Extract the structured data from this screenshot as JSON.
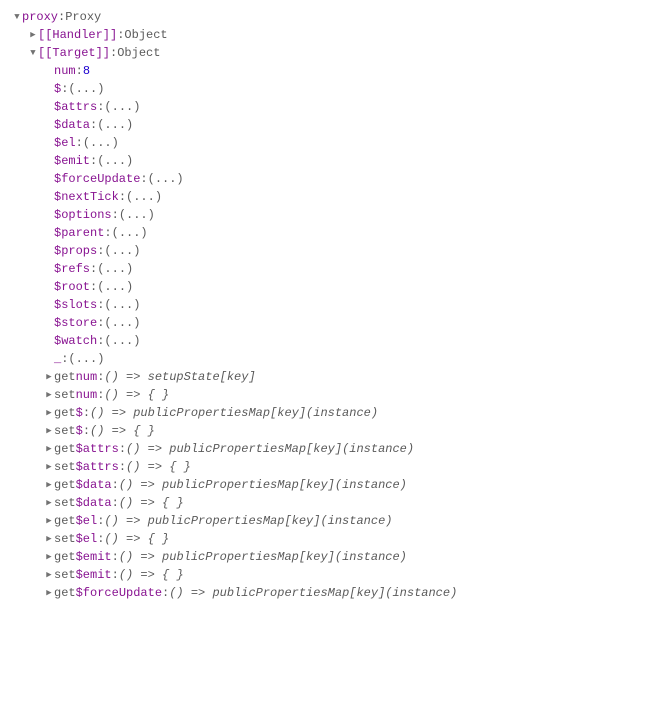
{
  "root": {
    "key": "proxy",
    "type": "Proxy"
  },
  "handler": {
    "key": "[[Handler]]",
    "type": "Object"
  },
  "target": {
    "key": "[[Target]]",
    "type": "Object"
  },
  "numEntry": {
    "key": "num",
    "value": "8"
  },
  "ellipsis": "(...)",
  "props": [
    "$",
    "$attrs",
    "$data",
    "$el",
    "$emit",
    "$forceUpdate",
    "$nextTick",
    "$options",
    "$parent",
    "$props",
    "$refs",
    "$root",
    "$slots",
    "$store",
    "$watch",
    "_"
  ],
  "accessors": [
    {
      "kind": "get",
      "name": "num",
      "body": "() => setupState[key]"
    },
    {
      "kind": "set",
      "name": "num",
      "body": "() => { }"
    },
    {
      "kind": "get",
      "name": "$",
      "body": "() => publicPropertiesMap[key](instance)"
    },
    {
      "kind": "set",
      "name": "$",
      "body": "() => { }"
    },
    {
      "kind": "get",
      "name": "$attrs",
      "body": "() => publicPropertiesMap[key](instance)"
    },
    {
      "kind": "set",
      "name": "$attrs",
      "body": "() => { }"
    },
    {
      "kind": "get",
      "name": "$data",
      "body": "() => publicPropertiesMap[key](instance)"
    },
    {
      "kind": "set",
      "name": "$data",
      "body": "() => { }"
    },
    {
      "kind": "get",
      "name": "$el",
      "body": "() => publicPropertiesMap[key](instance)"
    },
    {
      "kind": "set",
      "name": "$el",
      "body": "() => { }"
    },
    {
      "kind": "get",
      "name": "$emit",
      "body": "() => publicPropertiesMap[key](instance)"
    },
    {
      "kind": "set",
      "name": "$emit",
      "body": "() => { }"
    },
    {
      "kind": "get",
      "name": "$forceUpdate",
      "body": "() => publicPropertiesMap[key](instance)"
    }
  ]
}
